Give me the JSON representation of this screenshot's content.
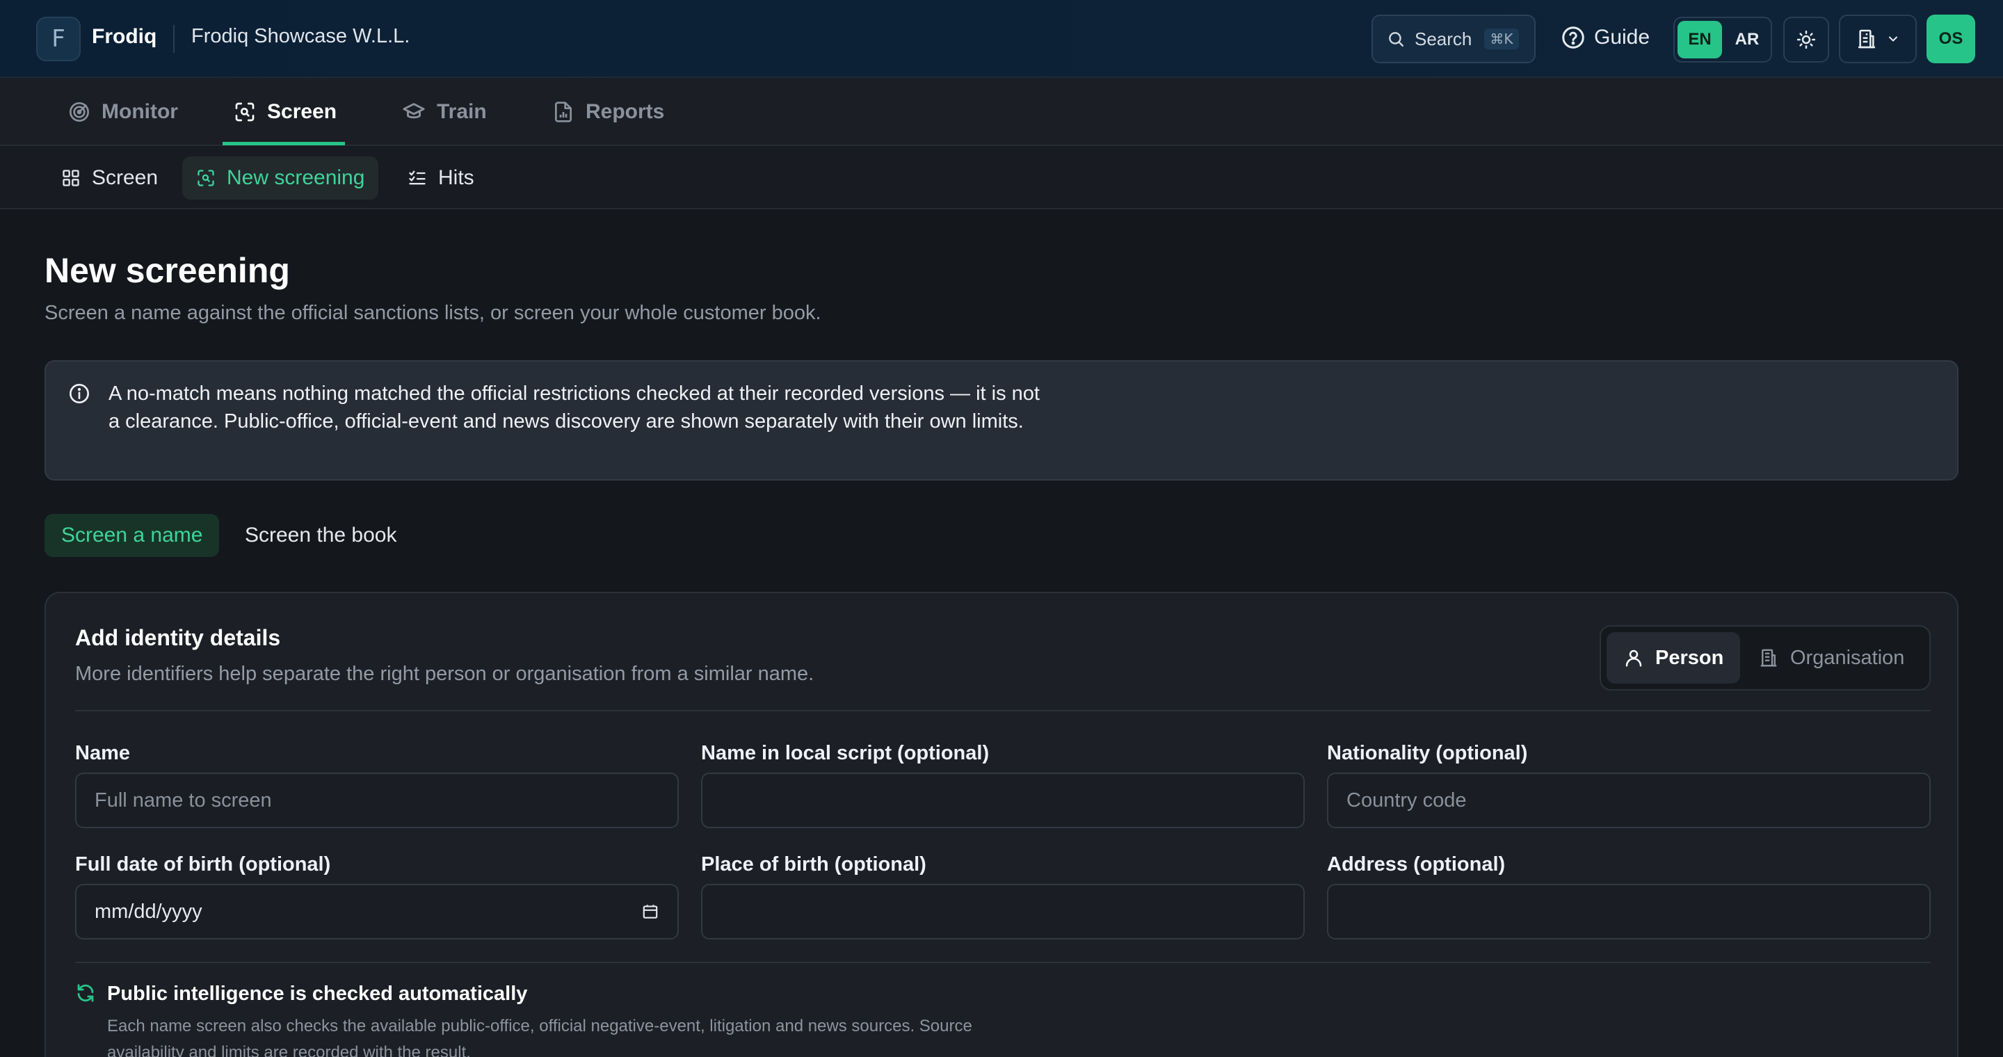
{
  "app": {
    "brand": "Frodiq",
    "logo_letter": "F",
    "org_name": "Frodiq Showcase W.L.L."
  },
  "topbar": {
    "search_label": "Search",
    "search_shortcut": "⌘K",
    "guide_label": "Guide",
    "lang_en": "EN",
    "lang_ar": "AR",
    "avatar_initials": "OS"
  },
  "tabs": [
    {
      "label": "Monitor",
      "icon": "radar-icon"
    },
    {
      "label": "Screen",
      "icon": "scan-face-icon",
      "active": true
    },
    {
      "label": "Train",
      "icon": "graduation-cap-icon"
    },
    {
      "label": "Reports",
      "icon": "file-chart-icon"
    }
  ],
  "subnav": [
    {
      "label": "Screen",
      "icon": "grid-icon"
    },
    {
      "label": "New screening",
      "icon": "scan-face-icon",
      "active": true
    },
    {
      "label": "Hits",
      "icon": "list-checks-icon"
    }
  ],
  "page": {
    "title": "New screening",
    "subtitle": "Screen a name against the official sanctions lists, or screen your whole customer book."
  },
  "notice": {
    "text": "A no-match means nothing matched the official restrictions checked at their recorded versions — it is not a clearance. Public-office, official-event and news discovery are shown separately with their own limits."
  },
  "mode_tabs": {
    "name": "Screen a name",
    "book": "Screen the book",
    "active": "name"
  },
  "form": {
    "title": "Add identity details",
    "subtitle": "More identifiers help separate the right person or organisation from a similar name.",
    "kind": {
      "person": "Person",
      "organisation": "Organisation",
      "active": "person"
    },
    "fields": {
      "name": {
        "label": "Name",
        "placeholder": "Full name to screen",
        "value": ""
      },
      "local_name": {
        "label": "Name in local script (optional)",
        "placeholder": "",
        "value": ""
      },
      "nationality": {
        "label": "Nationality (optional)",
        "placeholder": "Country code",
        "value": ""
      },
      "dob": {
        "label": "Full date of birth (optional)",
        "display": "mm/dd/yyyy"
      },
      "pob": {
        "label": "Place of birth (optional)",
        "placeholder": "",
        "value": ""
      },
      "address": {
        "label": "Address (optional)",
        "placeholder": "",
        "value": ""
      }
    },
    "intel": {
      "title": "Public intelligence is checked automatically",
      "text": "Each name screen also checks the available public-office, official negative-event, litigation and news sources. Source availability and limits are recorded with the result."
    }
  },
  "colors": {
    "accent": "#27c489",
    "accent_text": "#3fd49a",
    "background": "#14171c",
    "topbar": "#0c2137"
  }
}
